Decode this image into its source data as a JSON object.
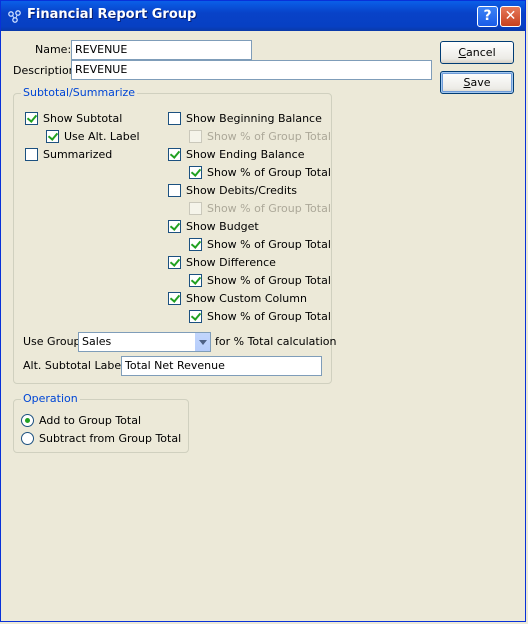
{
  "window": {
    "title": "Financial Report Group"
  },
  "form": {
    "name_label": "Name:",
    "name_value": "REVENUE",
    "description_label": "Description",
    "description_value": "REVENUE"
  },
  "buttons": {
    "cancel": "Cancel",
    "save": "Save"
  },
  "subtotal": {
    "legend": "Subtotal/Summarize",
    "show_subtotal": {
      "label": "Show Subtotal",
      "checked": true
    },
    "use_alt_label": {
      "label": "Use Alt. Label",
      "checked": true
    },
    "summarized": {
      "label": "Summarized",
      "checked": false
    },
    "beginning_balance": {
      "label": "Show Beginning Balance",
      "checked": false,
      "pct_label": "Show % of Group Total",
      "pct_checked": false,
      "pct_enabled": false
    },
    "ending_balance": {
      "label": "Show Ending Balance",
      "checked": true,
      "pct_label": "Show % of Group Total",
      "pct_checked": true,
      "pct_enabled": true
    },
    "debits_credits": {
      "label": "Show Debits/Credits",
      "checked": false,
      "pct_label": "Show % of Group Total",
      "pct_checked": false,
      "pct_enabled": false
    },
    "budget": {
      "label": "Show Budget",
      "checked": true,
      "pct_label": "Show % of Group Total",
      "pct_checked": true,
      "pct_enabled": true
    },
    "difference": {
      "label": "Show Difference",
      "checked": true,
      "pct_label": "Show % of Group Total",
      "pct_checked": true,
      "pct_enabled": true
    },
    "custom_column": {
      "label": "Show Custom Column",
      "checked": true,
      "pct_label": "Show % of Group Total",
      "pct_checked": true,
      "pct_enabled": true
    },
    "use_group_label": "Use Group",
    "use_group_value": "Sales",
    "pct_calc_label": "for % Total calculation",
    "alt_subtotal_label": "Alt. Subtotal Label:",
    "alt_subtotal_value": "Total Net Revenue"
  },
  "operation": {
    "legend": "Operation",
    "add": {
      "label": "Add to Group Total",
      "selected": true
    },
    "subtract": {
      "label": "Subtract from Group Total",
      "selected": false
    }
  },
  "colors": {
    "accent": "#0046d5",
    "check": "#21a121",
    "title_bar": "#0842c8"
  }
}
